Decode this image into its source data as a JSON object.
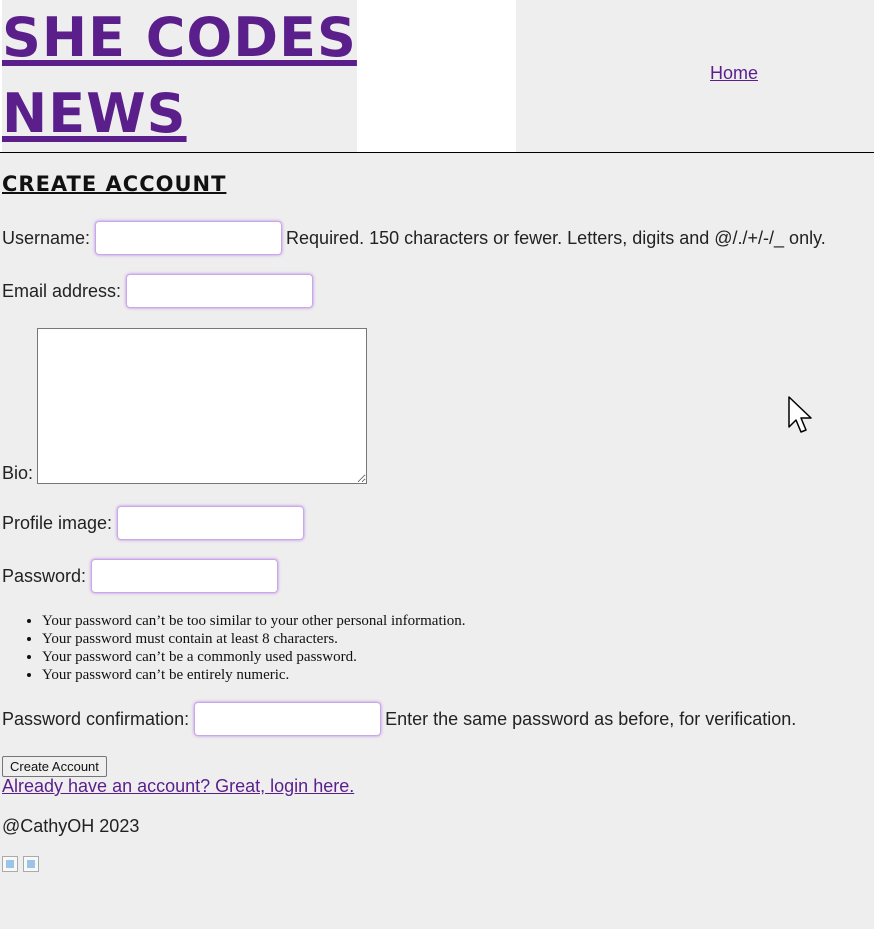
{
  "header": {
    "brand_line1": "SHE CODES",
    "brand_line2": "NEWS",
    "nav_home": "Home"
  },
  "form": {
    "title": "CREATE ACCOUNT",
    "username_label": "Username:",
    "username_help": "Required. 150 characters or fewer. Letters, digits and @/./+/-/_ only.",
    "email_label": "Email address:",
    "bio_label": "Bio:",
    "profile_image_label": "Profile image:",
    "password_label": "Password:",
    "password_rules": [
      "Your password can’t be too similar to your other personal information.",
      "Your password must contain at least 8 characters.",
      "Your password can’t be a commonly used password.",
      "Your password can’t be entirely numeric."
    ],
    "password_confirm_label": "Password confirmation:",
    "password_confirm_help": "Enter the same password as before, for verification.",
    "submit_label": "Create Account",
    "login_link": "Already have an account? Great, login here."
  },
  "footer": {
    "copyright": "@CathyOH 2023"
  },
  "colors": {
    "brand": "#5a1f8b",
    "background": "#eeeeee",
    "field_glow": "#c28ae8"
  }
}
